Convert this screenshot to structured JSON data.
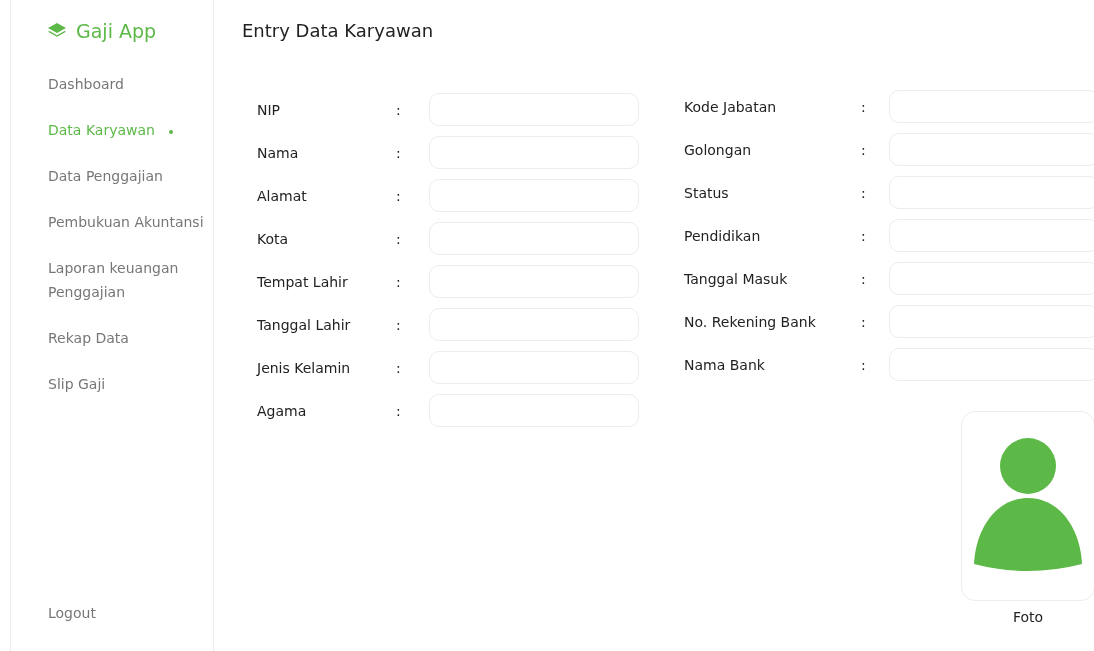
{
  "sidebar": {
    "brand": "Gaji App",
    "items": [
      {
        "label": "Dashboard",
        "selected": false
      },
      {
        "label": "Data Karyawan",
        "selected": true
      },
      {
        "label": "Data Penggajian",
        "selected": false
      },
      {
        "label": "Pembukuan Akuntansi",
        "selected": false
      },
      {
        "label": "Laporan keuangan Penggajian",
        "selected": false
      },
      {
        "label": "Rekap Data",
        "selected": false
      },
      {
        "label": "Slip Gaji",
        "selected": false
      }
    ],
    "logout": "Logout"
  },
  "page_title": "Entry Data Karyawan",
  "form": {
    "left_fields": [
      {
        "label": "NIP",
        "separator": ":"
      },
      {
        "label": "Nama",
        "separator": ":"
      },
      {
        "label": "Alamat",
        "separator": ":"
      },
      {
        "label": "Kota",
        "separator": ":"
      },
      {
        "label": "Tempat Lahir",
        "separator": ":"
      },
      {
        "label": "Tanggal Lahir",
        "separator": ":"
      },
      {
        "label": "Jenis Kelamin",
        "separator": ":"
      },
      {
        "label": "Agama",
        "separator": ":"
      }
    ],
    "right_fields": [
      {
        "label": "Kode Jabatan",
        "separator": ":"
      },
      {
        "label": "Golongan",
        "separator": ":"
      },
      {
        "label": "Status",
        "separator": ":"
      },
      {
        "label": "Pendidikan",
        "separator": ":"
      },
      {
        "label": "Tanggal Masuk",
        "separator": ":"
      },
      {
        "label": "No. Rekening Bank",
        "separator": ":"
      },
      {
        "label": "Nama Bank",
        "separator": ":"
      }
    ]
  },
  "photo": {
    "caption": "Foto"
  }
}
